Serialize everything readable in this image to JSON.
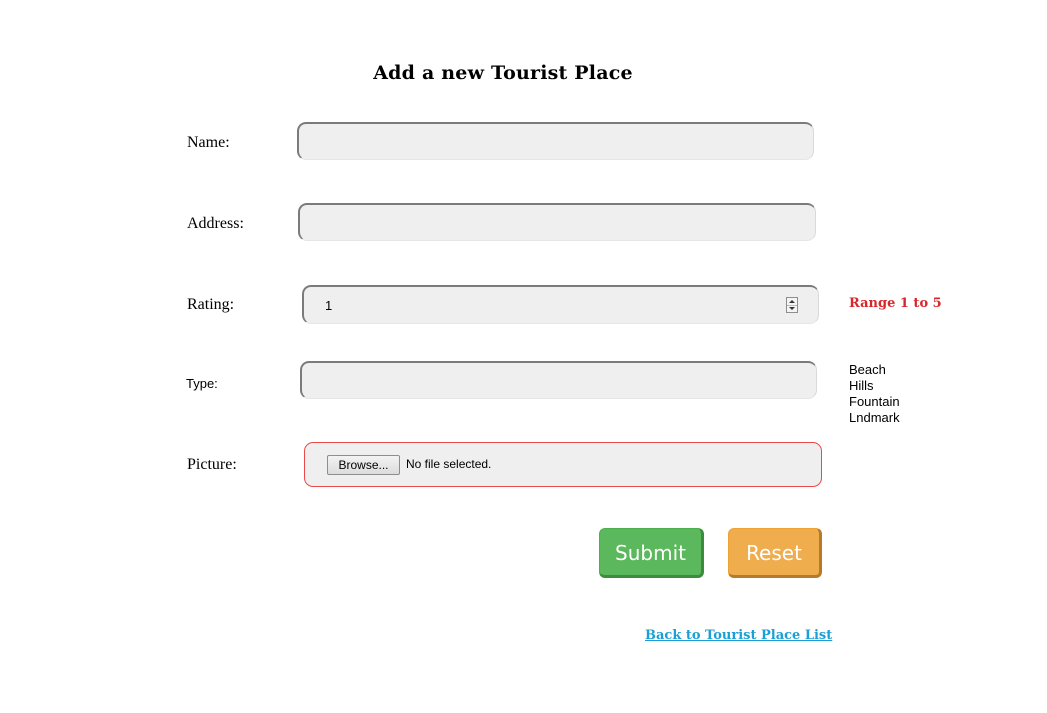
{
  "form": {
    "title": "Add a new Tourist Place",
    "name": {
      "label": "Name:",
      "value": ""
    },
    "address": {
      "label": "Address:",
      "value": ""
    },
    "rating": {
      "label": "Rating:",
      "value": "1",
      "range_note": "Range 1 to 5"
    },
    "type": {
      "label": "Type:",
      "value": "",
      "options": [
        "Beach",
        "Hills",
        "Fountain",
        "Lndmark"
      ]
    },
    "picture": {
      "label": "Picture:",
      "browse_label": "Browse...",
      "status": "No file selected."
    },
    "submit_label": "Submit",
    "reset_label": "Reset",
    "back_link": "Back to Tourist Place List"
  },
  "colors": {
    "submit": "#5cb85c",
    "reset": "#f0ad4e",
    "range_note": "#d9262b",
    "link": "#1a9fd6",
    "file_border": "#e94a4a"
  }
}
